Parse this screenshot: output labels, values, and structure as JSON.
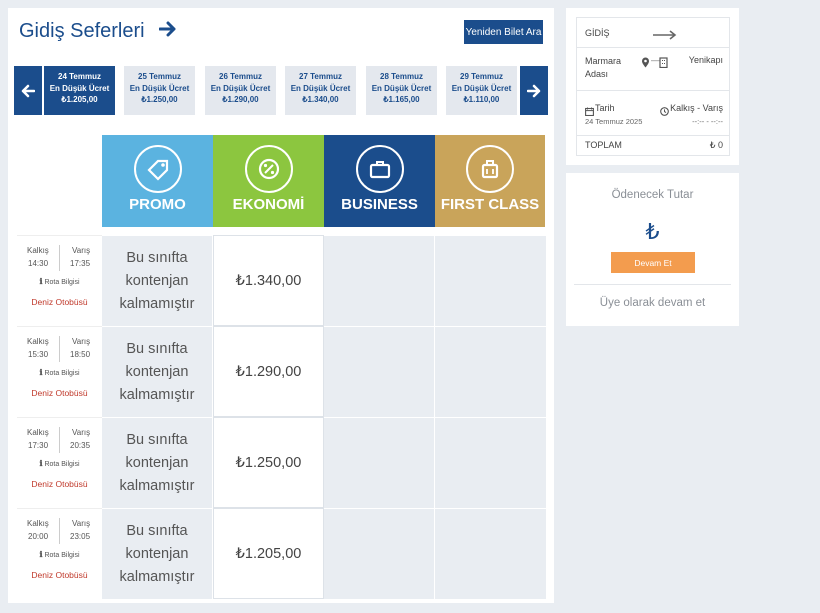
{
  "main": {
    "title": "Gidiş Seferleri",
    "search_again": "Yeniden Bilet Ara",
    "dates": [
      {
        "date": "24 Temmuz",
        "label": "En Düşük Ücret",
        "price": "₺1.205,00",
        "active": true
      },
      {
        "date": "25 Temmuz",
        "label": "En Düşük Ücret",
        "price": "₺1.250,00",
        "active": false
      },
      {
        "date": "26 Temmuz",
        "label": "En Düşük Ücret",
        "price": "₺1.290,00",
        "active": false
      },
      {
        "date": "27 Temmuz",
        "label": "En Düşük Ücret",
        "price": "₺1.340,00",
        "active": false
      },
      {
        "date": "28 Temmuz",
        "label": "En Düşük Ücret",
        "price": "₺1.165,00",
        "active": false
      },
      {
        "date": "29 Temmuz",
        "label": "En Düşük Ücret",
        "price": "₺1.110,00",
        "active": false
      }
    ],
    "classes": [
      {
        "name": "PROMO",
        "icon": "tag-icon",
        "color": "#5bb3e0"
      },
      {
        "name": "EKONOMİ",
        "icon": "discount-icon",
        "color": "#8cc63f"
      },
      {
        "name": "BUSINESS",
        "icon": "briefcase-icon",
        "color": "#1b4d8c"
      },
      {
        "name": "FIRST CLASS",
        "icon": "luggage-icon",
        "color": "#c9a45a"
      }
    ],
    "rows": [
      {
        "dep_label": "Kalkış",
        "dep": "14:30",
        "arr_label": "Varış",
        "arr": "17:35",
        "route": "Rota Bilgisi",
        "vehicle": "Deniz Otobüsü",
        "promo": "Bu sınıfta kontenjan kalmamıştır",
        "economy": "₺1.340,00"
      },
      {
        "dep_label": "Kalkış",
        "dep": "15:30",
        "arr_label": "Varış",
        "arr": "18:50",
        "route": "Rota Bilgisi",
        "vehicle": "Deniz Otobüsü",
        "promo": "Bu sınıfta kontenjan kalmamıştır",
        "economy": "₺1.290,00"
      },
      {
        "dep_label": "Kalkış",
        "dep": "17:30",
        "arr_label": "Varış",
        "arr": "20:35",
        "route": "Rota Bilgisi",
        "vehicle": "Deniz Otobüsü",
        "promo": "Bu sınıfta kontenjan kalmamıştır",
        "economy": "₺1.250,00"
      },
      {
        "dep_label": "Kalkış",
        "dep": "20:00",
        "arr_label": "Varış",
        "arr": "23:05",
        "route": "Rota Bilgisi",
        "vehicle": "Deniz Otobüsü",
        "promo": "Bu sınıfta kontenjan kalmamıştır",
        "economy": "₺1.205,00"
      }
    ]
  },
  "summary": {
    "heading": "GİDİŞ",
    "from": "Marmara Adası",
    "to": "Yenikapı",
    "date_label": "Tarih",
    "date_value": "24 Temmuz 2025",
    "time_label": "Kalkış - Varış",
    "time_value": "--:-- - --:--",
    "total_label": "TOPLAM",
    "total_value": "₺ 0"
  },
  "payment": {
    "title": "Ödenecek Tutar",
    "currency": "₺",
    "continue": "Devam Et",
    "member": "Üye olarak devam et"
  }
}
